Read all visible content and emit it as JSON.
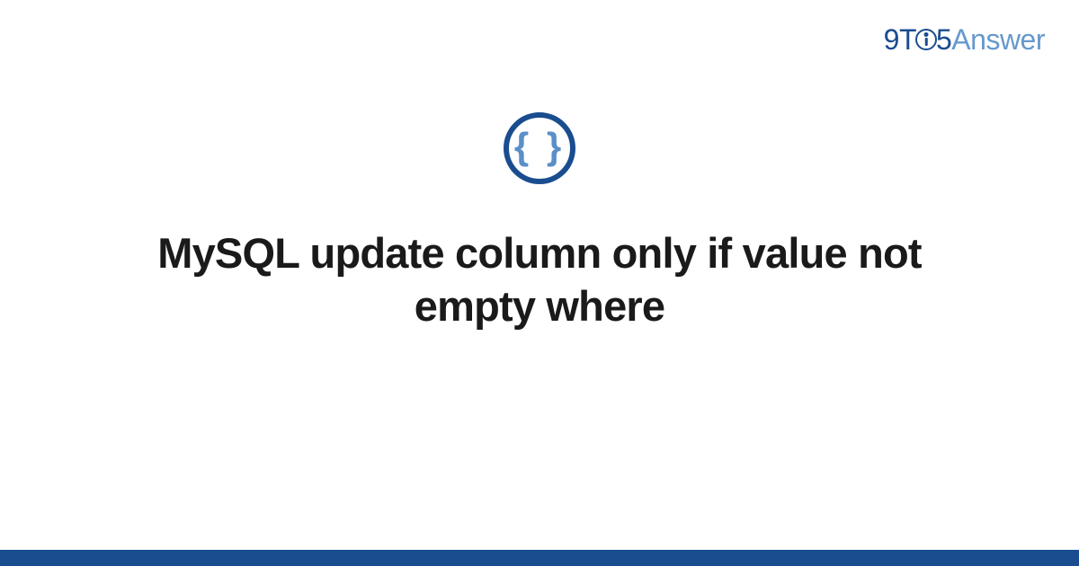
{
  "logo": {
    "part1": "9",
    "part2": "T",
    "part3": "5",
    "part4": "Answer"
  },
  "icon": {
    "name": "code-braces-icon",
    "glyph": "{ }"
  },
  "title": "MySQL update column only if value not empty where",
  "colors": {
    "primary": "#1a4d8f",
    "secondary": "#6699cc",
    "accent": "#5a8fc7"
  }
}
